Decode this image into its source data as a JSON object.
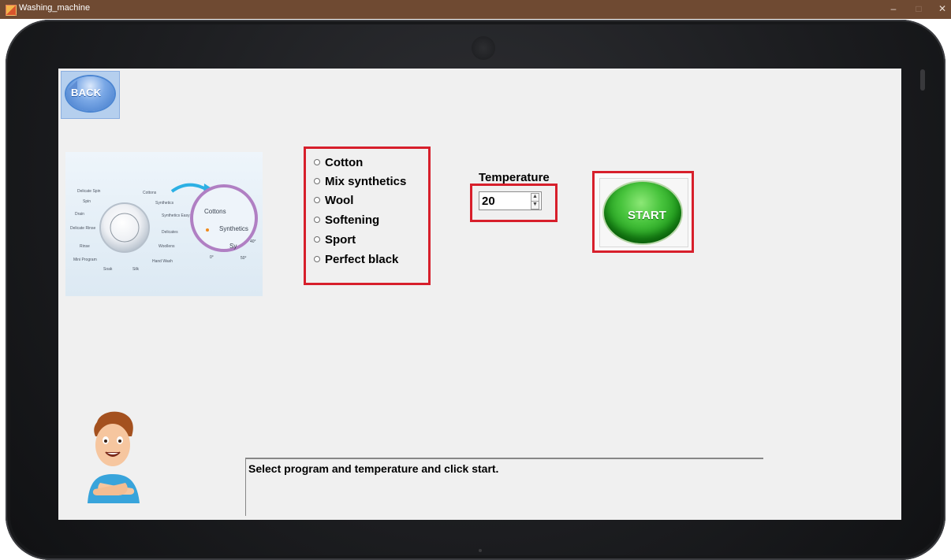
{
  "window": {
    "title": "Washing_machine",
    "controls": [
      "–",
      "□",
      "✕"
    ]
  },
  "navigation": {
    "back_label": "BACK"
  },
  "illustration": {
    "dial_labels": [
      "Delicate Spin",
      "Spin",
      "Drain",
      "Delicate Rinse",
      "Rinse",
      "Mini Program",
      "Soak",
      "Silk",
      "Hand Wash",
      "Woollens",
      "Delicates",
      "Synthetics Easy Iron",
      "Synthetics",
      "Cottons"
    ],
    "zoom_labels": [
      "Cottons",
      "Synthetics",
      "Sy",
      "40°",
      "50°",
      "0°"
    ]
  },
  "programs": [
    {
      "label": "Cotton"
    },
    {
      "label": "Mix synthetics"
    },
    {
      "label": "Wool"
    },
    {
      "label": "Softening"
    },
    {
      "label": "Sport"
    },
    {
      "label": "Perfect black"
    }
  ],
  "temperature": {
    "label": "Temperature",
    "value": "20"
  },
  "start_button": {
    "label": "START"
  },
  "status": {
    "message": "Select program and temperature and click start."
  },
  "colors": {
    "title_bar": "#6f4a32",
    "highlight": "#d71f2b",
    "screen": "#f0f0f0",
    "start_green": "#2ea82b",
    "back_blue": "#4c86d2"
  }
}
